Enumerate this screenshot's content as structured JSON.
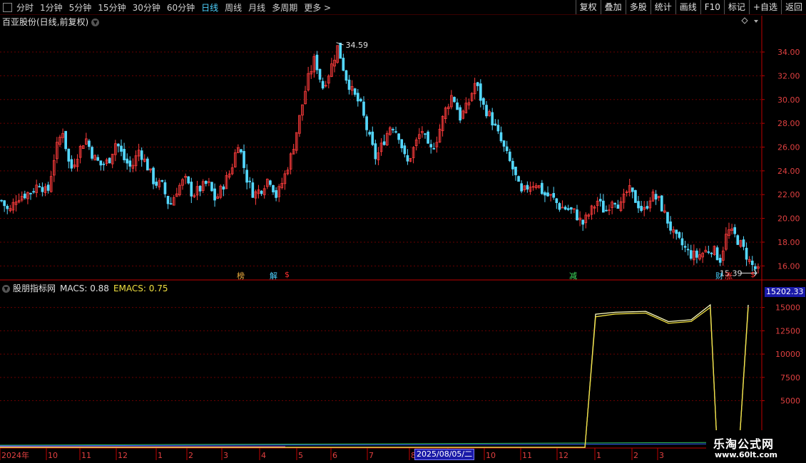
{
  "toolbar": {
    "periods": [
      "分时",
      "1分钟",
      "5分钟",
      "15分钟",
      "30分钟",
      "60分钟",
      "日线",
      "周线",
      "月线",
      "多周期",
      "更多 >"
    ],
    "active_period": "日线",
    "buttons": [
      "复权",
      "叠加",
      "多股",
      "统计",
      "画线",
      "F10",
      "标记",
      "+自选",
      "返回"
    ]
  },
  "main_title": "百亚股份(日线,前复权)",
  "indicator": {
    "name": "股朋指标网",
    "macs_label": "MACS: 0.88",
    "emacs_label": "EMACS: 0.75",
    "current_value": "15202.33"
  },
  "price_high_label": "34.59",
  "price_low_label": "15.39",
  "markers": [
    {
      "text": "榜",
      "color": "#f0b040"
    },
    {
      "text": "解",
      "color": "#4fd2ff"
    },
    {
      "text": "$",
      "color": "#ff3030"
    },
    {
      "text": "减",
      "color": "#40e060"
    },
    {
      "text": "财",
      "color": "#4fd2ff"
    },
    {
      "text": "涨",
      "color": "#ff3030"
    },
    {
      "text": "$",
      "color": "#ff3030"
    }
  ],
  "date_axis": {
    "labels": [
      "2024年",
      "10",
      "11",
      "12",
      "1",
      "2",
      "3",
      "4",
      "5",
      "6",
      "7",
      "8",
      "9",
      "10",
      "11",
      "12",
      "1",
      "2",
      "3"
    ],
    "selected_date": "2025/08/05/二"
  },
  "watermark": {
    "line1": "乐淘公式网",
    "line2": "www.60lt.com"
  },
  "colors": {
    "up": "#ff3c3c",
    "down": "#54d8ff",
    "axis": "#c00000",
    "macs": "#ffffc0",
    "emacs": "#f0e040"
  },
  "chart_data": [
    {
      "type": "candlestick",
      "title": "百亚股份(日线,前复权)",
      "ylim": [
        15,
        35.5
      ],
      "y_ticks": [
        16.0,
        18.0,
        20.0,
        22.0,
        24.0,
        26.0,
        28.0,
        30.0,
        32.0,
        34.0
      ],
      "close_path": [
        21.5,
        20.5,
        21.8,
        22.0,
        22.3,
        23.0,
        22.0,
        25.5,
        27.5,
        24.0,
        25.5,
        26.8,
        25.2,
        24.5,
        24.8,
        26.5,
        25.0,
        24.2,
        25.8,
        24.5,
        23.0,
        22.8,
        21.0,
        22.5,
        23.3,
        22.0,
        22.5,
        23.0,
        21.5,
        22.8,
        24.0,
        26.5,
        23.5,
        22.0,
        22.5,
        23.5,
        21.8,
        23.5,
        25.5,
        28.5,
        31.5,
        33.5,
        31.0,
        32.5,
        34.5,
        32.0,
        30.5,
        29.5,
        27.0,
        25.0,
        26.5,
        28.0,
        27.0,
        24.5,
        26.0,
        27.5,
        25.5,
        26.8,
        29.0,
        30.5,
        28.5,
        29.5,
        31.5,
        29.5,
        28.5,
        27.0,
        25.5,
        24.0,
        22.0,
        22.8,
        23.0,
        22.0,
        21.8,
        21.0,
        20.8,
        20.5,
        19.5,
        20.5,
        21.5,
        20.5,
        21.8,
        21.0,
        22.5,
        21.5,
        20.5,
        22.0,
        21.5,
        20.0,
        18.5,
        17.8,
        17.0,
        16.8,
        17.2,
        17.5,
        16.5,
        19.0,
        18.5,
        17.5,
        16.2,
        15.5
      ],
      "high_label": "34.59",
      "low_label": "15.39"
    },
    {
      "type": "line",
      "title": "股朋指标网",
      "ylim": [
        0,
        16500
      ],
      "y_ticks": [
        5000,
        7500,
        10000,
        12500,
        15000
      ],
      "series": [
        {
          "name": "MACS",
          "path": [
            [
              0.0,
              0
            ],
            [
              0.77,
              0
            ],
            [
              0.784,
              14200
            ],
            [
              0.81,
              14400
            ],
            [
              0.85,
              14500
            ],
            [
              0.88,
              13400
            ],
            [
              0.91,
              13600
            ],
            [
              0.935,
              15200
            ],
            [
              0.944,
              0
            ],
            [
              0.973,
              0
            ],
            [
              0.985,
              15200
            ]
          ]
        },
        {
          "name": "EMACS",
          "path": [
            [
              0.0,
              0
            ],
            [
              0.77,
              0
            ],
            [
              0.784,
              14000
            ],
            [
              0.81,
              14300
            ],
            [
              0.85,
              14400
            ],
            [
              0.88,
              13300
            ],
            [
              0.91,
              13500
            ],
            [
              0.935,
              15000
            ],
            [
              0.944,
              0
            ],
            [
              0.973,
              0
            ],
            [
              0.985,
              15000
            ]
          ]
        }
      ]
    }
  ]
}
